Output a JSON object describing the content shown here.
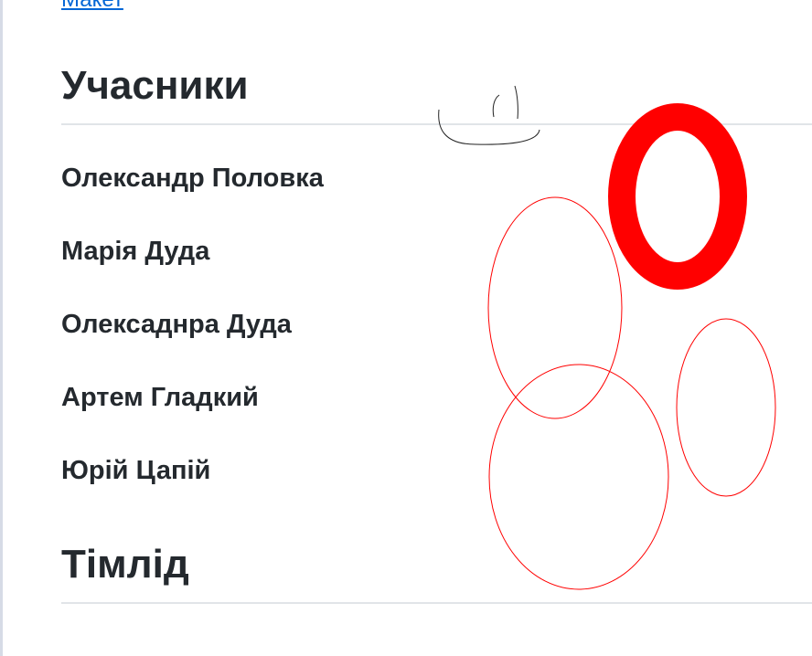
{
  "top_link": {
    "label": "Макет"
  },
  "sections": {
    "participants": {
      "title": "Учасники",
      "members": [
        "Олександр Половка",
        "Марія Дуда",
        "Олексаднра Дуда",
        "Артем Гладкий",
        "Юрій Цапій"
      ]
    },
    "teamlead": {
      "title": "Тімлід"
    }
  },
  "colors": {
    "text": "#24292e",
    "link": "#0366d6",
    "rule": "#e1e4e8",
    "annotation": "#ff0000",
    "sketch": "#222222"
  }
}
